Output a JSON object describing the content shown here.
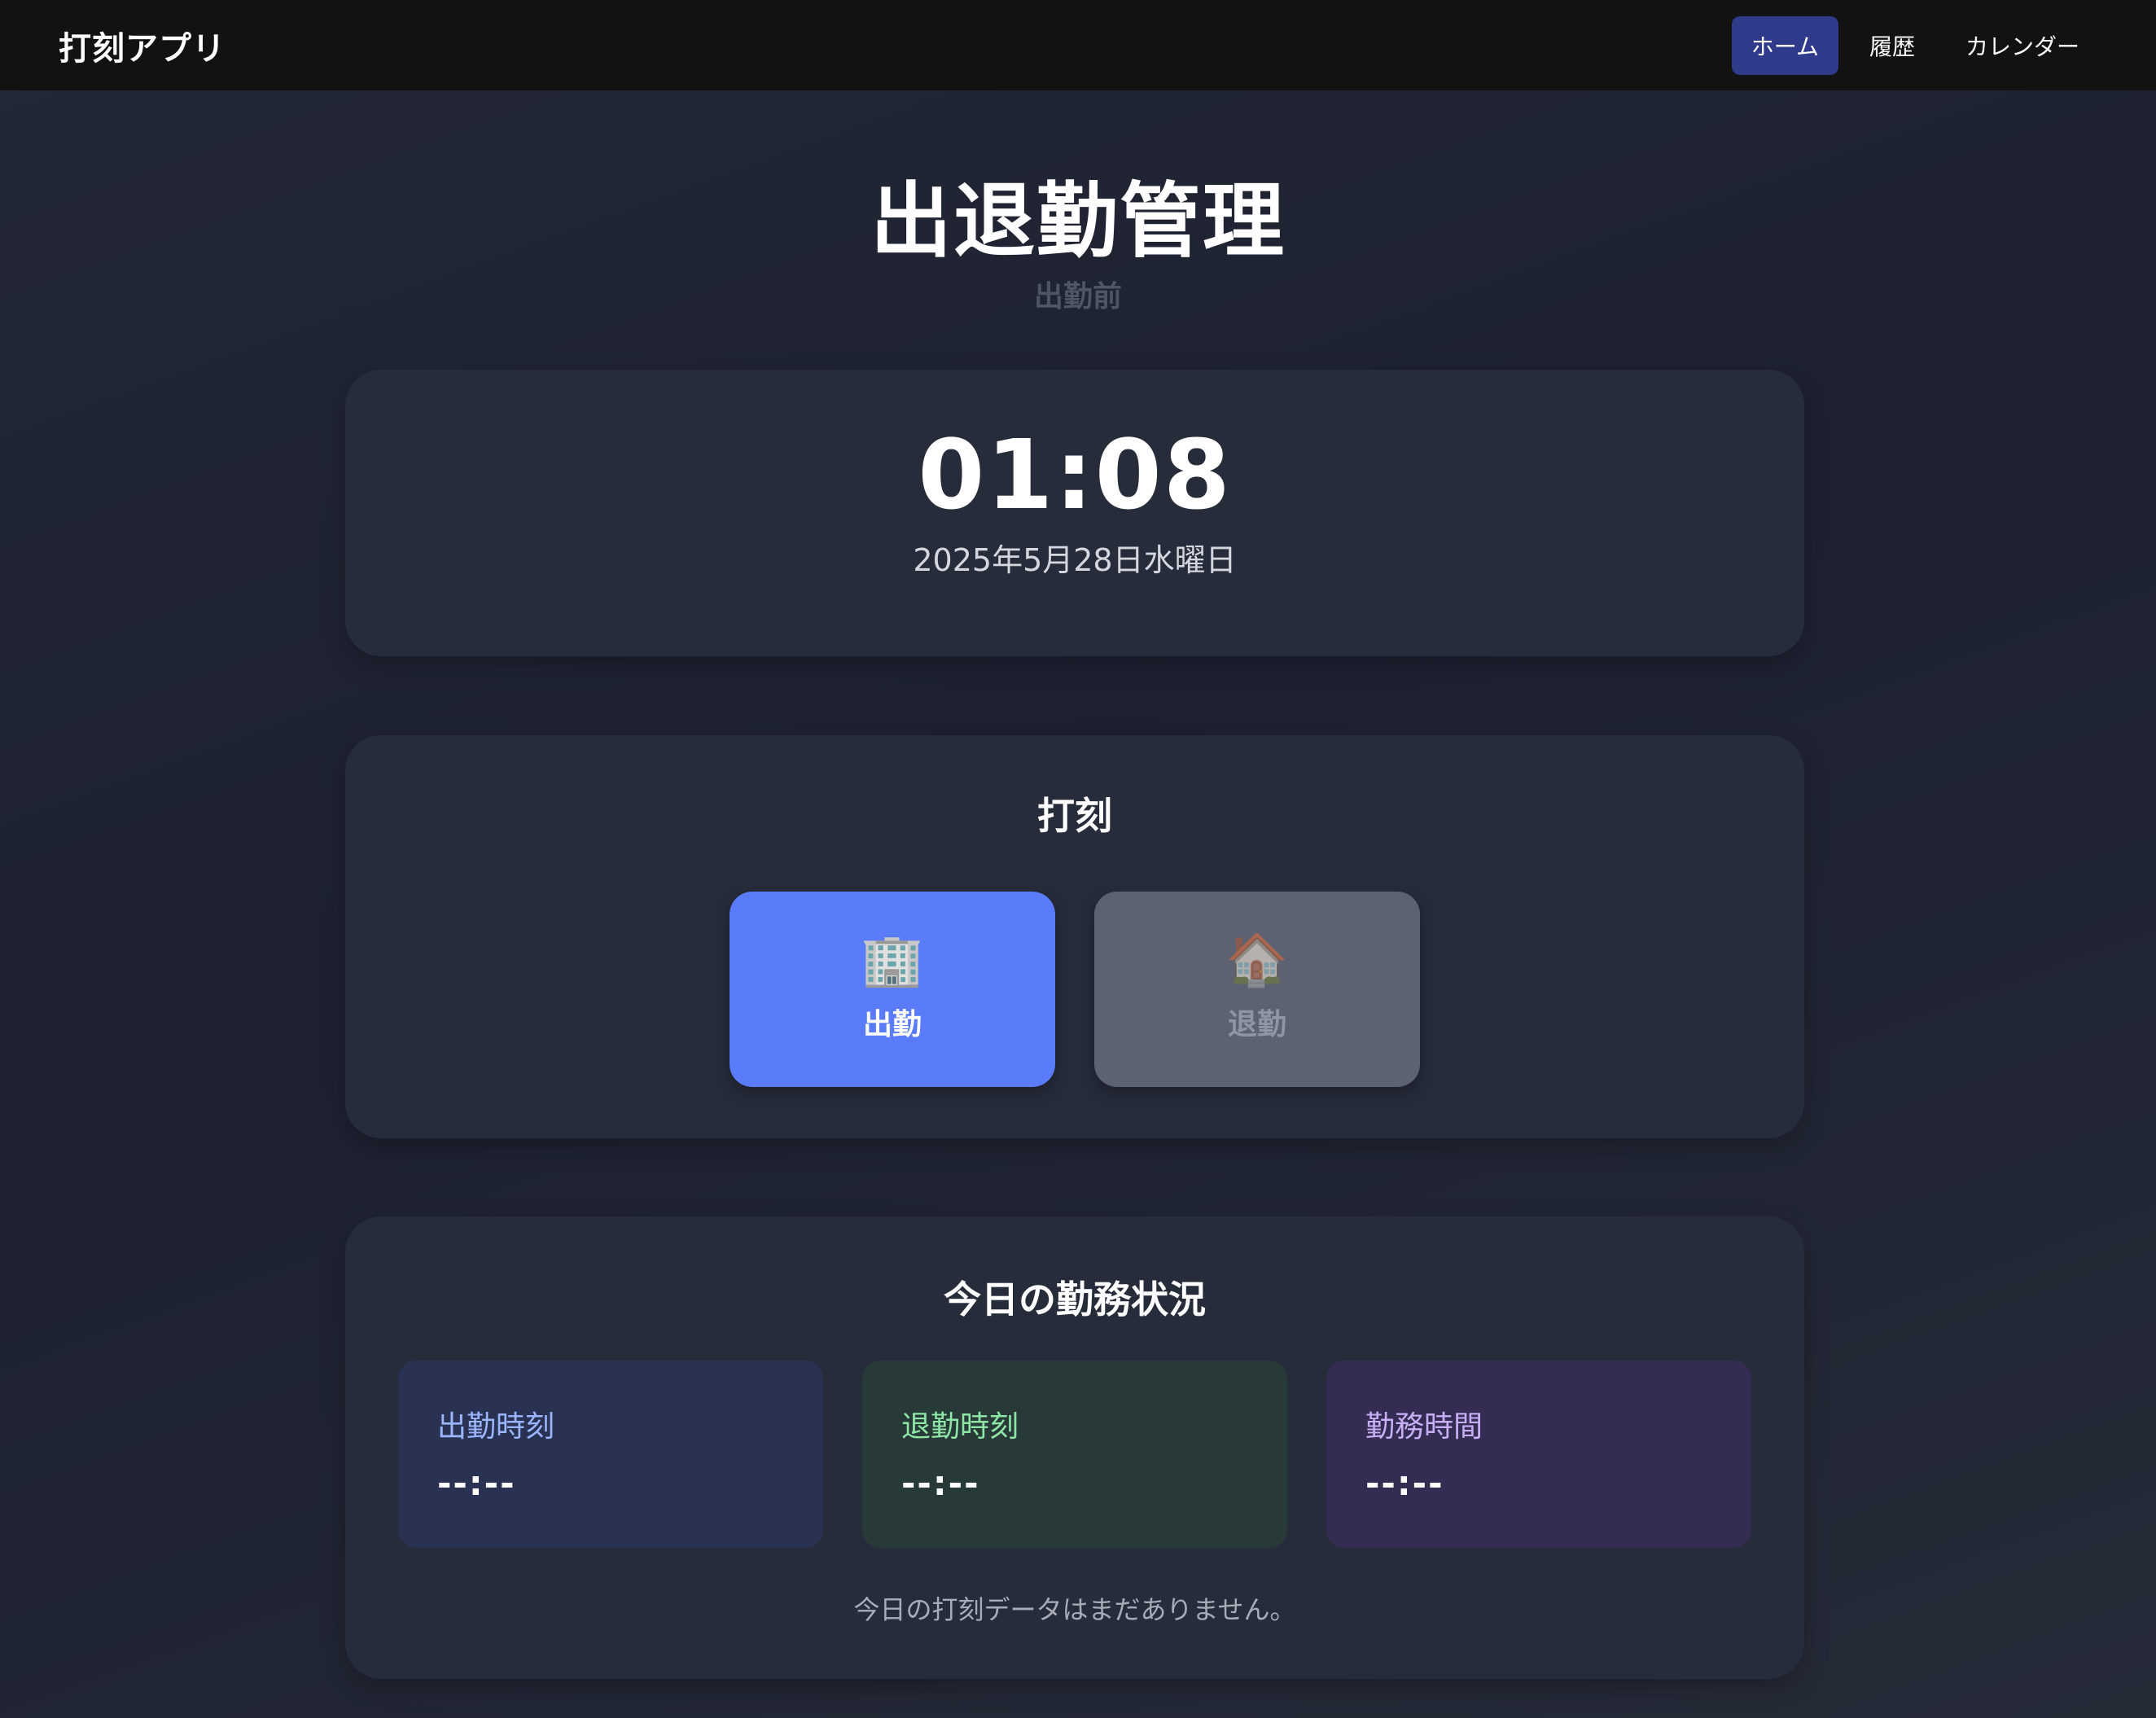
{
  "nav": {
    "brand": "打刻アプリ",
    "items": [
      {
        "label": "ホーム",
        "active": true
      },
      {
        "label": "履歴",
        "active": false
      },
      {
        "label": "カレンダー",
        "active": false
      }
    ]
  },
  "header": {
    "title": "出退勤管理",
    "status": "出勤前"
  },
  "clock": {
    "time": "01:08",
    "date": "2025年5月28日水曜日"
  },
  "punch": {
    "title": "打刻",
    "clock_in": {
      "icon": "office-building-icon",
      "label": "出勤",
      "glyph": "🏢"
    },
    "clock_out": {
      "icon": "house-icon",
      "label": "退勤",
      "glyph": "🏠"
    }
  },
  "today": {
    "title": "今日の勤務状況",
    "stats": [
      {
        "label": "出勤時刻",
        "value": "--:--"
      },
      {
        "label": "退勤時刻",
        "value": "--:--"
      },
      {
        "label": "勤務時間",
        "value": "--:--"
      }
    ],
    "empty_message": "今日の打刻データはまだありません。"
  },
  "colors": {
    "nav_active": "#2f3a8a",
    "clock_in_button": "#5b7cfa",
    "clock_out_button": "#5c6272",
    "stat_in_bg": "#293253",
    "stat_out_bg": "#283a37",
    "stat_hours_bg": "#342c53"
  }
}
